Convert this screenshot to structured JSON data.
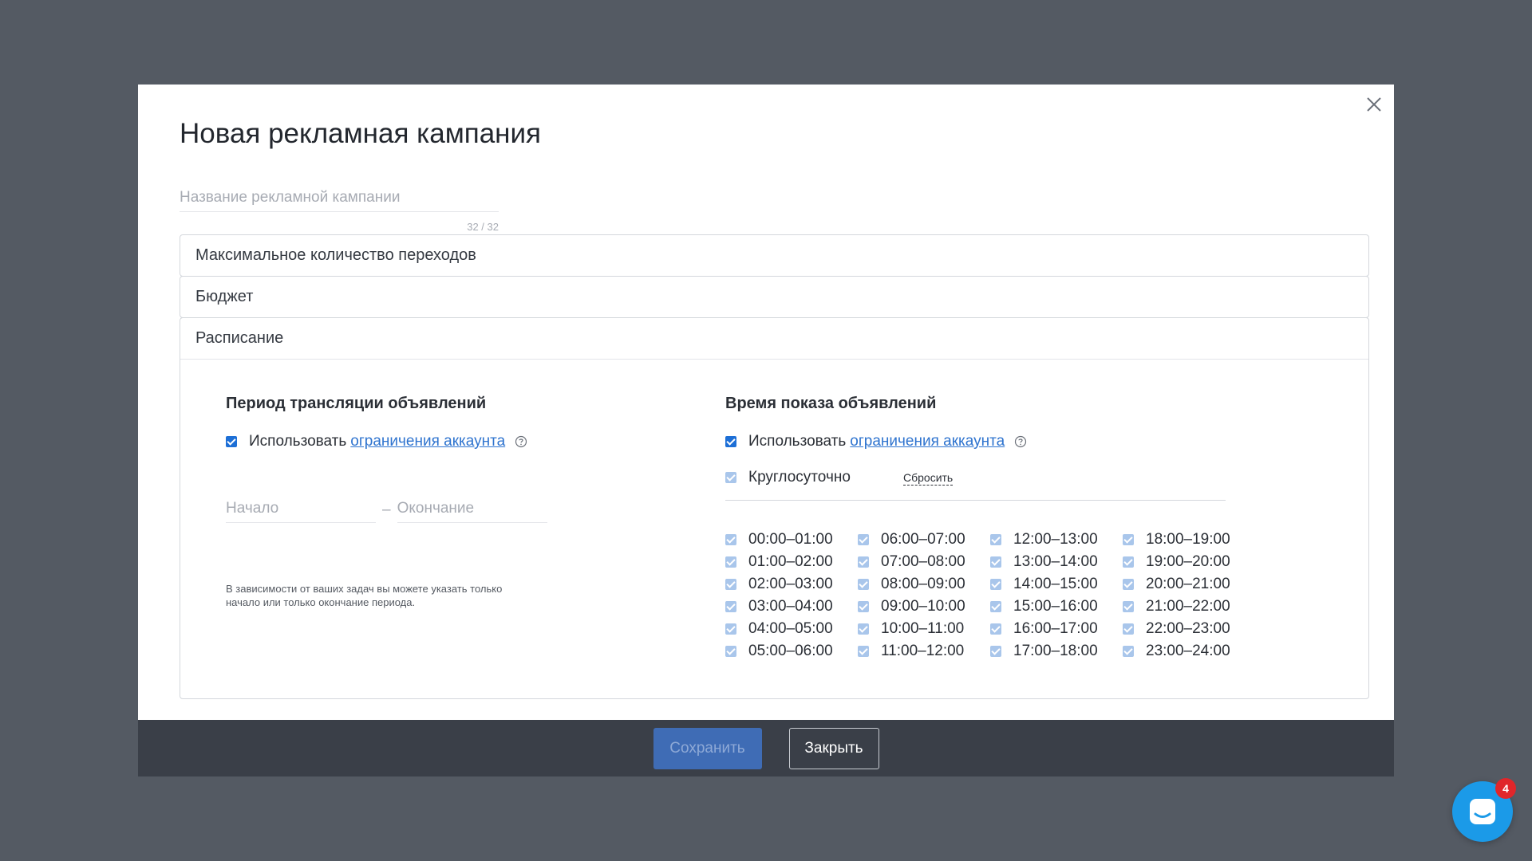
{
  "dialog": {
    "title": "Новая рекламная кампания",
    "name_placeholder": "Название рекламной кампании",
    "name_value": "",
    "name_counter": "32 / 32"
  },
  "sections": {
    "max_clicks": "Максимальное количество переходов",
    "budget": "Бюджет",
    "schedule": "Расписание"
  },
  "period": {
    "title": "Период трансляции объявлений",
    "use_label": "Использовать",
    "account_limits_link": "ограничения аккаунта",
    "start_placeholder": "Начало",
    "dash": "–",
    "end_placeholder": "Окончание",
    "hint": "В зависимости от ваших задач вы можете указать только начало или только окончание периода."
  },
  "show_time": {
    "title": "Время показа объявлений",
    "use_label": "Использовать",
    "account_limits_link": "ограничения аккаунта",
    "around_clock_label": "Круглосуточно",
    "reset_label": "Сбросить",
    "hours": [
      "00:00–01:00",
      "01:00–02:00",
      "02:00–03:00",
      "03:00–04:00",
      "04:00–05:00",
      "05:00–06:00",
      "06:00–07:00",
      "07:00–08:00",
      "08:00–09:00",
      "09:00–10:00",
      "10:00–11:00",
      "11:00–12:00",
      "12:00–13:00",
      "13:00–14:00",
      "14:00–15:00",
      "15:00–16:00",
      "16:00–17:00",
      "17:00–18:00",
      "18:00–19:00",
      "19:00–20:00",
      "20:00–21:00",
      "21:00–22:00",
      "22:00–23:00",
      "23:00–24:00"
    ]
  },
  "footer": {
    "save_label": "Сохранить",
    "close_label": "Закрыть"
  },
  "chat": {
    "badge_count": "4"
  },
  "colors": {
    "backdrop": "#545a63",
    "accent": "#1d6fd6",
    "link": "#2f74cf",
    "footer": "#3a3f48",
    "chat": "#1b9ae8",
    "badge": "#e0262a"
  }
}
